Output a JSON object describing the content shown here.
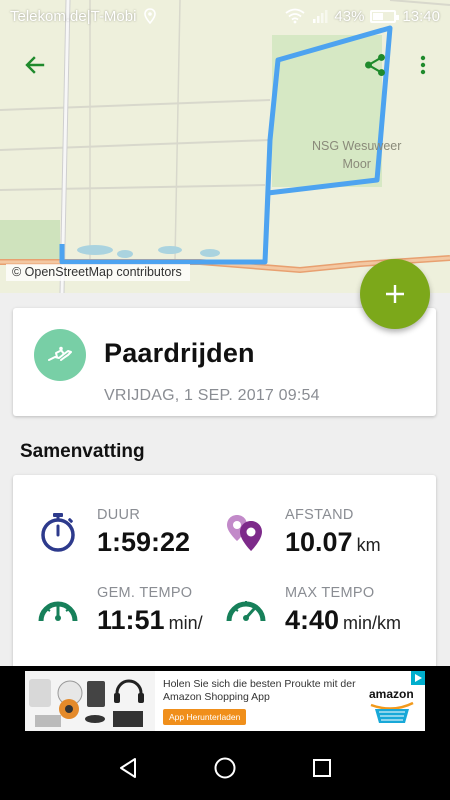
{
  "status_bar": {
    "carrier": "Telekom.de|T-Mobi",
    "battery": "43%",
    "time": "13:40",
    "signal_label": "R"
  },
  "map": {
    "attribution": "© OpenStreetMap contributors",
    "place_label_line1": "NSG Wesuweer",
    "place_label_line2": "Moor",
    "route_color": "#4da3f0"
  },
  "toolbar": {
    "back_icon": "arrow-left-icon",
    "share_icon": "share-icon",
    "menu_icon": "more-vert-icon",
    "accent": "#1f8a2c"
  },
  "fab": {
    "icon": "plus-icon",
    "color": "#7ca81a"
  },
  "activity": {
    "title": "Paardrijden",
    "date": "VRIJDAG, 1 SEP. 2017 09:54",
    "icon": "horse-riding-icon",
    "icon_bg": "#78cfa6"
  },
  "summary": {
    "title": "Samenvatting",
    "stats": [
      {
        "label": "DUUR",
        "value": "1:59:22",
        "unit": "",
        "icon": "stopwatch-icon"
      },
      {
        "label": "AFSTAND",
        "value": "10.07",
        "unit": "km",
        "icon": "map-pins-icon"
      },
      {
        "label": "GEM. TEMPO",
        "value": "11:51",
        "unit": "min/",
        "icon": "speedometer-icon"
      },
      {
        "label": "MAX TEMPO",
        "value": "4:40",
        "unit": "min/km",
        "icon": "speedometer-max-icon"
      }
    ]
  },
  "ad": {
    "text": "Holen Sie sich die besten Proukte mit der Amazon Shopping App",
    "button": "App Herunterladen",
    "brand": "amazon"
  },
  "nav": {
    "back": "back-triangle-icon",
    "home": "home-circle-icon",
    "recents": "recents-square-icon"
  }
}
